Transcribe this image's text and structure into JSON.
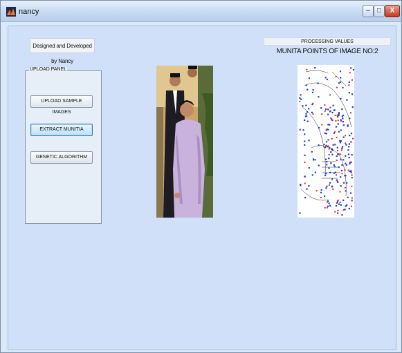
{
  "window": {
    "title": "nancy",
    "minimize_label": "–",
    "maximize_label": "□",
    "close_label": "X"
  },
  "credits": {
    "text": "Designed and Developed by Nancy"
  },
  "upload_panel": {
    "title": "UPLOAD PANEL",
    "buttons": [
      {
        "label": "UPLOAD SAMPLE IMAGES"
      },
      {
        "label": "EXTRACT MUNITIA"
      },
      {
        "label": "GENETIC ALGORITHM"
      }
    ]
  },
  "processing": {
    "header": "PROCESSING VALUES",
    "subtitle": "MUNITA POINTS OF IMAGE NO:2"
  },
  "colors": {
    "accent_blue": "#1f3fd6",
    "accent_red": "#e02020"
  }
}
